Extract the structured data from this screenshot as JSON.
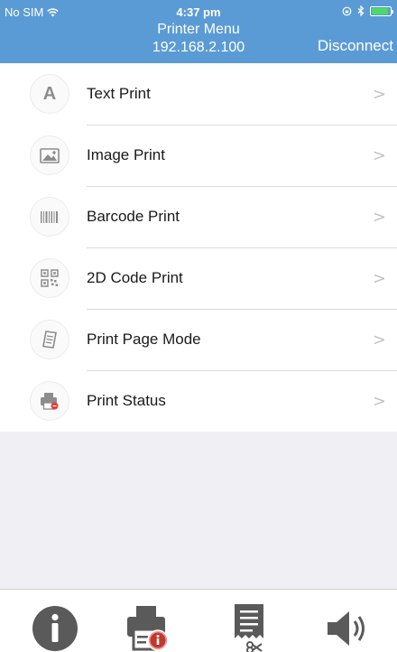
{
  "status_bar": {
    "carrier": "No SIM",
    "time": "4:37 pm"
  },
  "nav": {
    "title": "Printer Menu",
    "subtitle": "192.168.2.100",
    "action": "Disconnect"
  },
  "menu": {
    "items": [
      {
        "label": "Text Print",
        "icon": "text-a-icon"
      },
      {
        "label": "Image Print",
        "icon": "image-icon"
      },
      {
        "label": "Barcode Print",
        "icon": "barcode-icon"
      },
      {
        "label": "2D Code Print",
        "icon": "qr-code-icon"
      },
      {
        "label": "Print Page Mode",
        "icon": "page-icon"
      },
      {
        "label": "Print Status",
        "icon": "printer-status-icon"
      }
    ],
    "chevron": ">"
  },
  "tabbar": {
    "tabs": [
      {
        "icon": "info-icon"
      },
      {
        "icon": "printer-info-icon"
      },
      {
        "icon": "receipt-cut-icon"
      },
      {
        "icon": "speaker-icon"
      }
    ]
  },
  "colors": {
    "header": "#5b9bd5",
    "battery": "#4cd964",
    "tab_icon": "#5a5a5a"
  }
}
